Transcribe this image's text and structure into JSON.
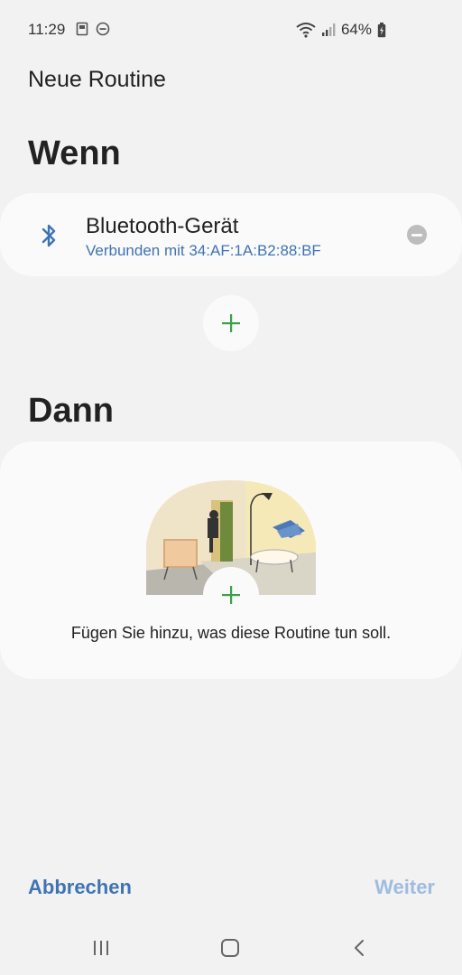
{
  "status_bar": {
    "time": "11:29",
    "battery": "64%"
  },
  "app_bar": {
    "title": "Neue Routine"
  },
  "if_section": {
    "title": "Wenn",
    "condition": {
      "icon": "bluetooth-icon",
      "title": "Bluetooth-Gerät",
      "subtitle": "Verbunden mit 34:AF:1A:B2:88:BF"
    }
  },
  "then_section": {
    "title": "Dann",
    "hint": "Fügen Sie hinzu, was diese Routine tun soll."
  },
  "actions": {
    "cancel": "Abbrechen",
    "next": "Weiter"
  },
  "colors": {
    "accent": "#3f73b5",
    "accent_disabled": "#9dbce0",
    "plus": "#3aa14a",
    "background": "#f2f2f2",
    "card": "#fafafa"
  }
}
